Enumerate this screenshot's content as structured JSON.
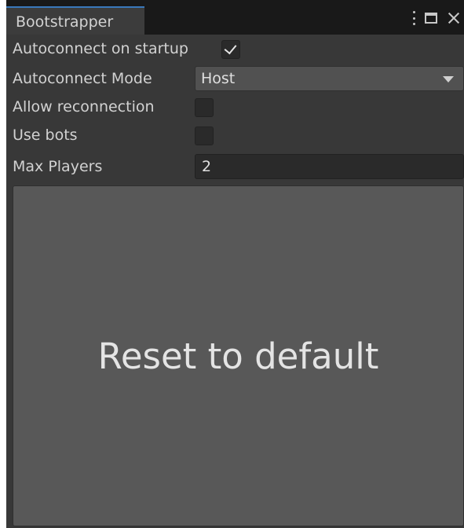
{
  "window": {
    "tab_title": "Bootstrapper",
    "icons": [
      "kebab-menu-icon",
      "maximize-icon",
      "close-icon"
    ]
  },
  "fields": {
    "autoconnect_on_startup": {
      "label": "Autoconnect on startup",
      "checked": true
    },
    "autoconnect_mode": {
      "label": "Autoconnect Mode",
      "value": "Host"
    },
    "allow_reconnection": {
      "label": "Allow reconnection",
      "checked": false
    },
    "use_bots": {
      "label": "Use bots",
      "checked": false
    },
    "max_players": {
      "label": "Max Players",
      "value": "2"
    }
  },
  "reset_button": {
    "label": "Reset to default"
  },
  "colors": {
    "panel_bg": "#383838",
    "header_bg": "#191919",
    "tab_accent": "#3a79bb",
    "button_bg": "#585858",
    "field_bg": "#2a2a2a"
  }
}
